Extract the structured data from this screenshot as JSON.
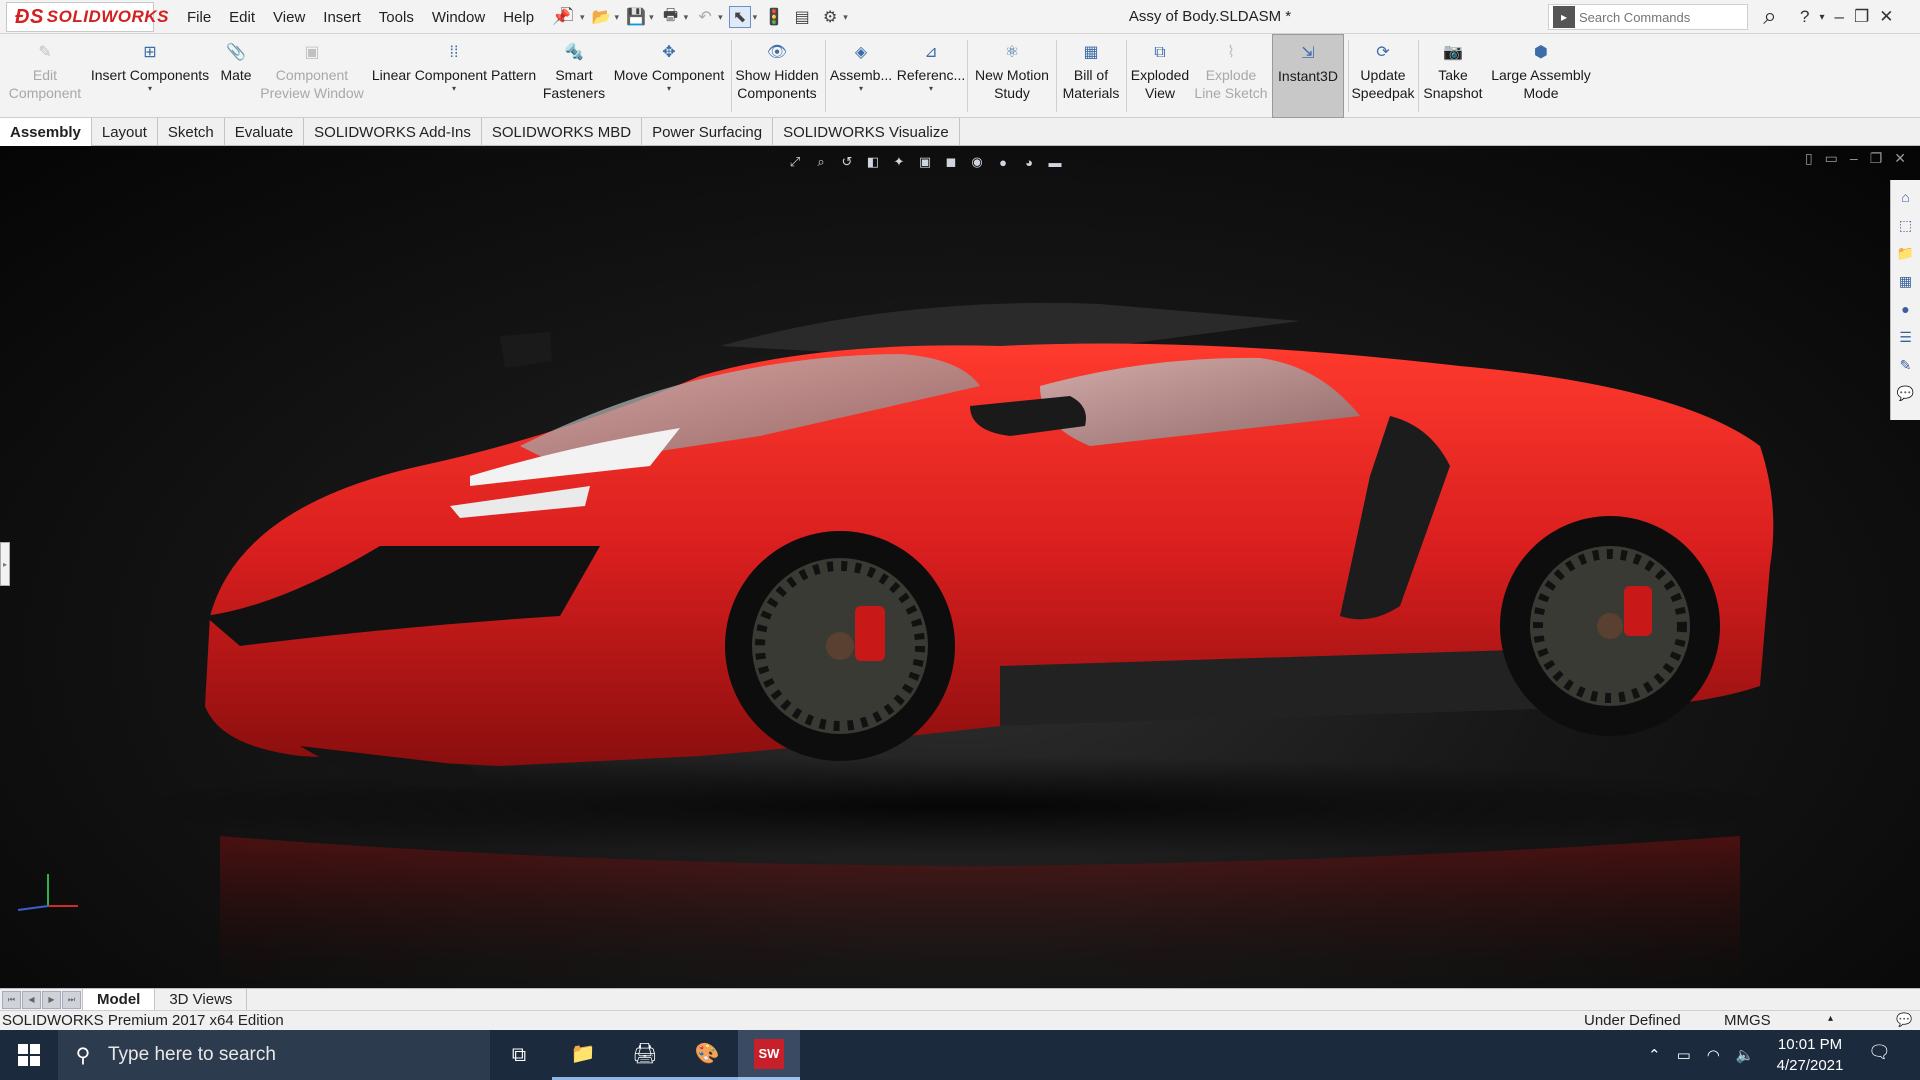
{
  "app": {
    "logo_text": "SOLIDWORKS",
    "document_title": "Assy of Body.SLDASM *",
    "menu": [
      "File",
      "Edit",
      "View",
      "Insert",
      "Tools",
      "Window",
      "Help"
    ],
    "search_placeholder": "Search Commands",
    "help_label": "?"
  },
  "command_manager": {
    "edit_component": "Edit\nComponent",
    "insert_components": "Insert Components",
    "mate": "Mate",
    "component_preview": "Component\nPreview Window",
    "linear_pattern": "Linear Component Pattern",
    "smart_fasteners": "Smart\nFasteners",
    "move_component": "Move Component",
    "show_hidden": "Show Hidden\nComponents",
    "assembly_features": "Assemb...",
    "reference_geometry": "Referenc...",
    "new_motion_study": "New Motion\nStudy",
    "bill_of_materials": "Bill of\nMaterials",
    "exploded_view": "Exploded\nView",
    "explode_line_sketch": "Explode\nLine Sketch",
    "instant3d": "Instant3D",
    "update_speedpak": "Update\nSpeedpak",
    "take_snapshot": "Take\nSnapshot",
    "large_assembly_mode": "Large Assembly\nMode"
  },
  "tabs": [
    "Assembly",
    "Layout",
    "Sketch",
    "Evaluate",
    "SOLIDWORKS Add-Ins",
    "SOLIDWORKS MBD",
    "Power Surfacing",
    "SOLIDWORKS Visualize"
  ],
  "model_tabs": [
    "Model",
    "3D Views"
  ],
  "status": {
    "edition": "SOLIDWORKS Premium 2017 x64 Edition",
    "definition": "Under Defined",
    "units": "MMGS"
  },
  "taskbar": {
    "search_text": "Type here to search",
    "time": "10:01 PM",
    "date": "4/27/2021",
    "sw_badge": "SW"
  },
  "colors": {
    "body_red": "#d81e1e",
    "accent_blue": "#3c6da8",
    "taskbar": "#1c2a3e"
  }
}
